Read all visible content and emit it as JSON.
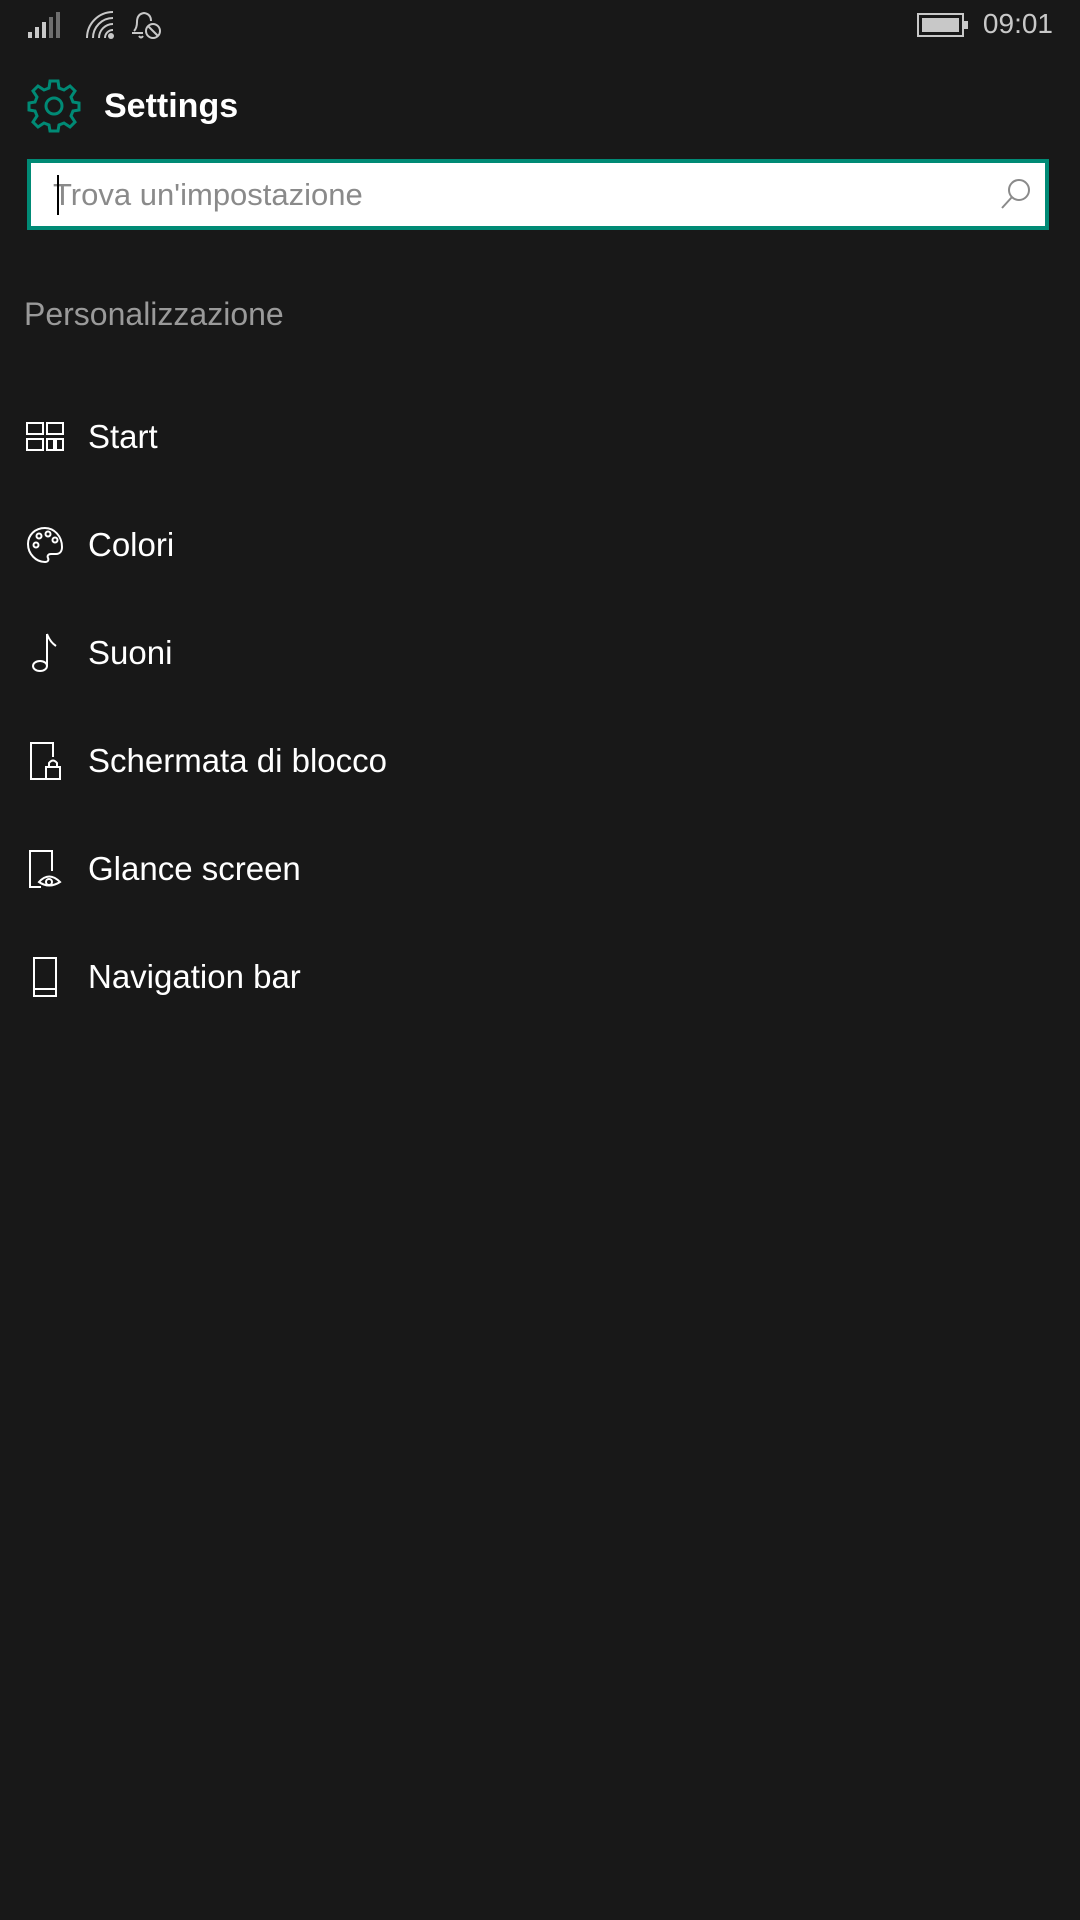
{
  "status_bar": {
    "time": "09:01",
    "icons": [
      "signal-strength-icon",
      "wifi-icon",
      "quiet-hours-icon",
      "battery-icon"
    ]
  },
  "header": {
    "title": "Settings",
    "icon": "gear-icon",
    "accent_color": "#008a75"
  },
  "search": {
    "value": "",
    "placeholder": "Trova un'impostazione",
    "icon": "search-icon"
  },
  "section": {
    "title": "Personalizzazione"
  },
  "menu": {
    "items": [
      {
        "label": "Start",
        "icon": "start-tiles-icon"
      },
      {
        "label": "Colori",
        "icon": "palette-icon"
      },
      {
        "label": "Suoni",
        "icon": "music-note-icon"
      },
      {
        "label": "Schermata di blocco",
        "icon": "lock-screen-icon"
      },
      {
        "label": "Glance screen",
        "icon": "glance-screen-icon"
      },
      {
        "label": "Navigation bar",
        "icon": "phone-icon"
      }
    ]
  },
  "colors": {
    "background": "#181818",
    "accent": "#008a75",
    "section_text": "#9a9a9a"
  }
}
